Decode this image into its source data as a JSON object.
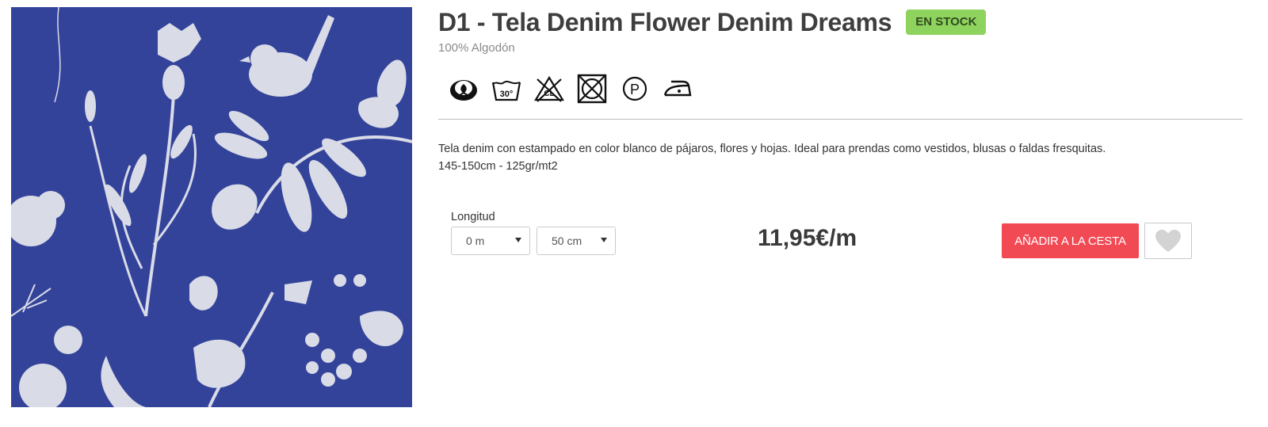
{
  "product": {
    "title": "D1 - Tela Denim Flower Denim Dreams",
    "stock_badge": "EN STOCK",
    "composition": "100% Algodón",
    "description_line1": "Tela denim con estampado en color blanco de pájaros, flores y hojas. Ideal para prendas como vestidos, blusas o faldas fresquitas.",
    "description_line2": "145-150cm - 125gr/mt2",
    "price": "11,95€/m",
    "image_icon": "floral-denim-fabric-image"
  },
  "care_icons": [
    {
      "name": "cotton-icon"
    },
    {
      "name": "wash-30-icon",
      "label": "30°"
    },
    {
      "name": "no-bleach-icon",
      "label": "CL"
    },
    {
      "name": "no-tumble-dry-icon"
    },
    {
      "name": "dry-clean-p-icon",
      "label": "P"
    },
    {
      "name": "iron-low-icon"
    }
  ],
  "purchase": {
    "length_label": "Longitud",
    "meters_value": "0 m",
    "centimeters_value": "50 cm",
    "add_to_cart_label": "AÑADIR A LA CESTA",
    "wishlist_icon": "heart-icon"
  },
  "colors": {
    "stock_badge": "#8fd35f",
    "add_button": "#f24a55",
    "fabric_blue": "#33439a"
  }
}
